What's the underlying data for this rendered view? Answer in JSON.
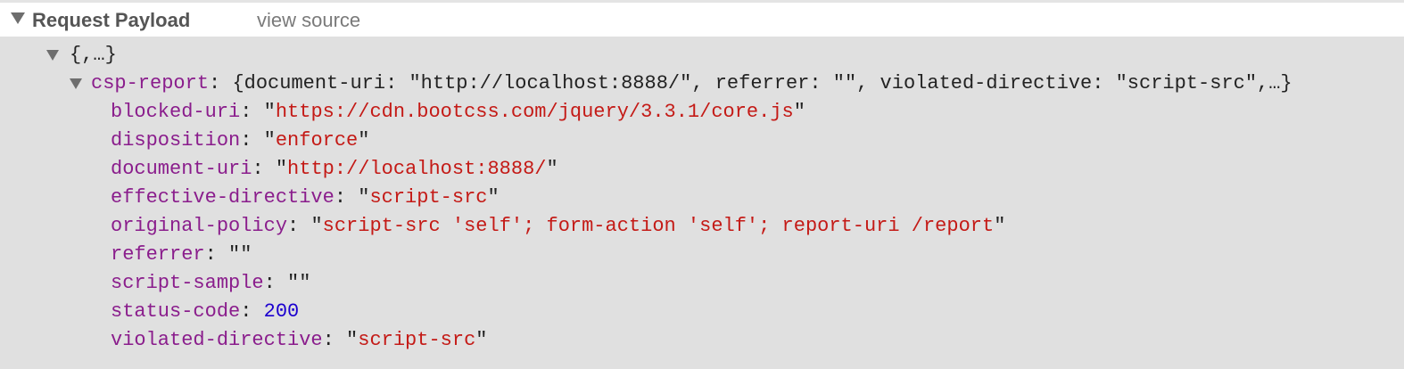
{
  "header": {
    "title": "Request Payload",
    "view_source": "view source"
  },
  "payload": {
    "root_label": "{,…}",
    "object_key": "csp-report",
    "object_preview": "{document-uri: \"http://localhost:8888/\", referrer: \"\", violated-directive: \"script-src\",…}",
    "fields": [
      {
        "key": "blocked-uri",
        "value": "https://cdn.bootcss.com/jquery/3.3.1/core.js",
        "type": "string"
      },
      {
        "key": "disposition",
        "value": "enforce",
        "type": "string"
      },
      {
        "key": "document-uri",
        "value": "http://localhost:8888/",
        "type": "string"
      },
      {
        "key": "effective-directive",
        "value": "script-src",
        "type": "string"
      },
      {
        "key": "original-policy",
        "value": "script-src 'self'; form-action 'self'; report-uri /report",
        "type": "string"
      },
      {
        "key": "referrer",
        "value": "",
        "type": "string"
      },
      {
        "key": "script-sample",
        "value": "",
        "type": "string"
      },
      {
        "key": "status-code",
        "value": "200",
        "type": "number"
      },
      {
        "key": "violated-directive",
        "value": "script-src",
        "type": "string"
      }
    ]
  }
}
